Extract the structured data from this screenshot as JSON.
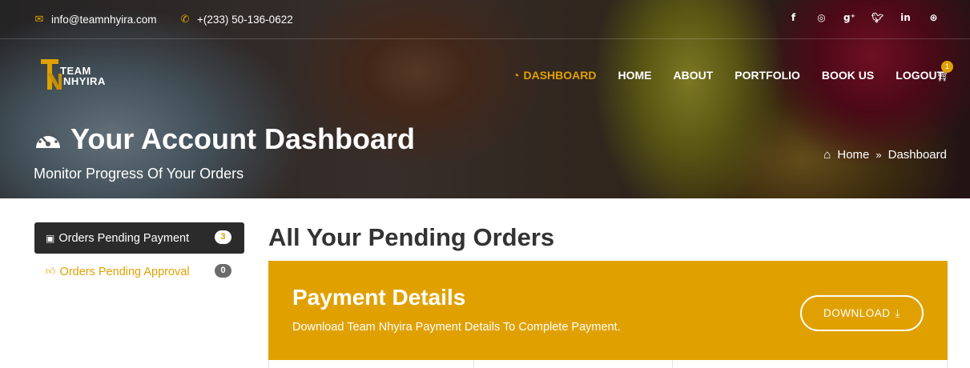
{
  "topbar": {
    "email": "info@teamnhyira.com",
    "phone": "+(233) 50-136-0622",
    "social_icons": [
      "facebook-icon",
      "instagram-icon",
      "google-plus-icon",
      "twitter-icon",
      "linkedin-icon",
      "dribbble-icon"
    ]
  },
  "logo": {
    "line1": "TEAM",
    "line2": "NHYIRA"
  },
  "nav": {
    "items": [
      {
        "label": "DASHBOARD",
        "active": true,
        "icon": "dashboard-icon"
      },
      {
        "label": "HOME",
        "active": false
      },
      {
        "label": "ABOUT",
        "active": false
      },
      {
        "label": "PORTFOLIO",
        "active": false
      },
      {
        "label": "BOOK US",
        "active": false
      },
      {
        "label": "LOGOUT",
        "active": false
      }
    ],
    "cart_count": "1"
  },
  "hero": {
    "title": "Your Account Dashboard",
    "subtitle": "Monitor Progress Of Your Orders",
    "breadcrumb": {
      "home": "Home",
      "current": "Dashboard"
    }
  },
  "sidebar": {
    "items": [
      {
        "label": "Orders Pending Payment",
        "count": "3",
        "icon": "money-icon",
        "active": true
      },
      {
        "label": "Orders Pending Approval",
        "count": "0",
        "icon": "thumbs-up-icon",
        "active": false
      }
    ]
  },
  "main": {
    "title": "All Your Pending Orders",
    "payment": {
      "heading": "Payment Details",
      "text": "Download Team Nhyira Payment Details To Complete Payment.",
      "download_label": "DOWNLOAD"
    }
  },
  "colors": {
    "accent": "#e0a100",
    "dark": "#2b2b2b"
  }
}
